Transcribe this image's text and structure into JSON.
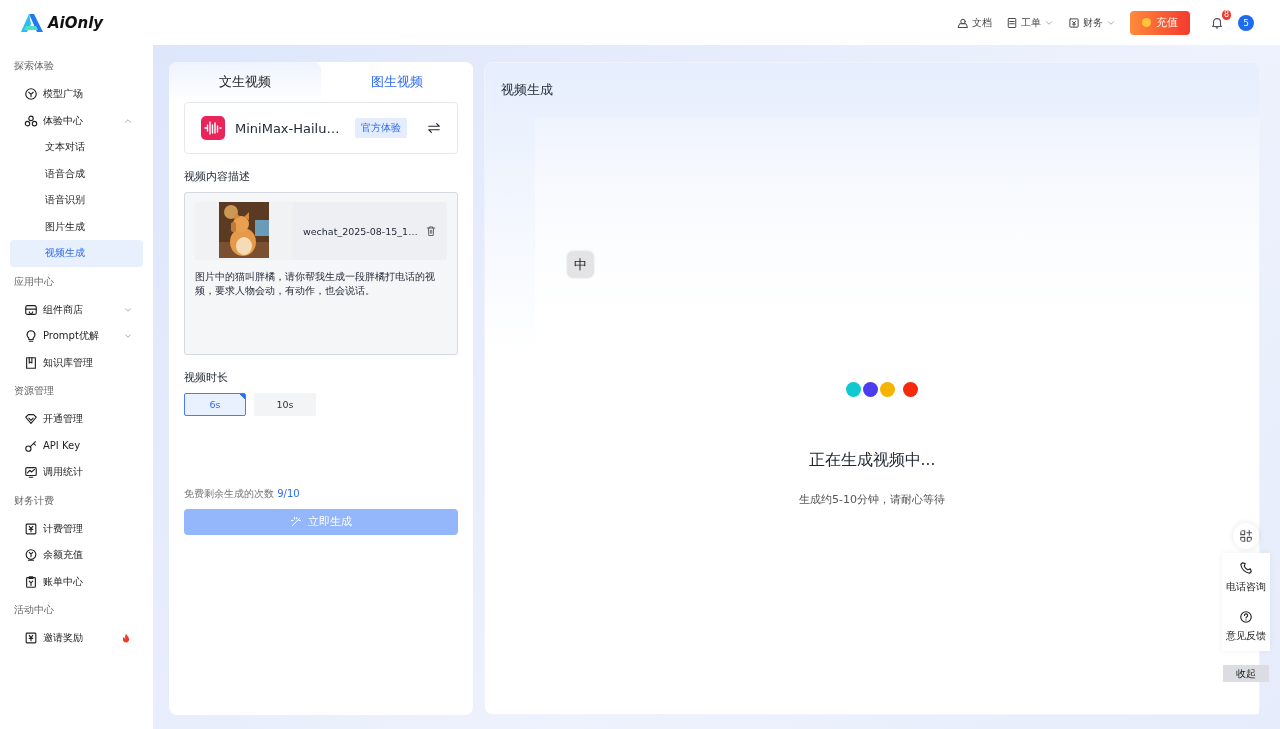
{
  "header": {
    "brand": "AiOnly",
    "nav": [
      {
        "label": "文档",
        "dropdown": false
      },
      {
        "label": "工单",
        "dropdown": true
      },
      {
        "label": "财务",
        "dropdown": true
      }
    ],
    "recharge": "充值",
    "notification_count": "8",
    "avatar": "5"
  },
  "sidebar": {
    "sections": [
      {
        "title": "探索体验",
        "items": [
          {
            "label": "模型广场",
            "selected": false
          },
          {
            "label": "体验中心",
            "selected": false,
            "expanded": true,
            "children": [
              {
                "label": "文本对话",
                "selected": false
              },
              {
                "label": "语音合成",
                "selected": false
              },
              {
                "label": "语音识别",
                "selected": false
              },
              {
                "label": "图片生成",
                "selected": false
              },
              {
                "label": "视频生成",
                "selected": true
              }
            ]
          }
        ]
      },
      {
        "title": "应用中心",
        "items": [
          {
            "label": "组件商店",
            "selected": false,
            "expanded": false
          },
          {
            "label": "Prompt优解",
            "selected": false,
            "expanded": false
          },
          {
            "label": "知识库管理",
            "selected": false
          }
        ]
      },
      {
        "title": "资源管理",
        "items": [
          {
            "label": "开通管理",
            "selected": false
          },
          {
            "label": "API Key",
            "selected": false
          },
          {
            "label": "调用统计",
            "selected": false
          }
        ]
      },
      {
        "title": "财务计费",
        "items": [
          {
            "label": "计费管理",
            "selected": false
          },
          {
            "label": "余额充值",
            "selected": false
          },
          {
            "label": "账单中心",
            "selected": false
          }
        ]
      },
      {
        "title": "活动中心",
        "items": [
          {
            "label": "邀请奖励",
            "selected": false,
            "hot": true
          }
        ]
      }
    ]
  },
  "left_panel": {
    "tabs": [
      {
        "label": "文生视频",
        "selected": false
      },
      {
        "label": "图生视频",
        "selected": true
      }
    ],
    "model": {
      "name": "MiniMax-Hailu…",
      "tag": "官方体验"
    },
    "description_label": "视频内容描述",
    "attachment": {
      "kind": "picture",
      "filename": "wechat_2025-08-15_1…"
    },
    "prompt": "图片中的猫叫胖橘，请你帮我生成一段胖橘打电话的视频，要求人物会动，有动作，也会说话。",
    "duration_label": "视频时长",
    "durations": [
      {
        "label": "6s",
        "selected": true
      },
      {
        "label": "10s",
        "selected": false
      }
    ],
    "quota_label": "免费剩余生成的次数",
    "quota": "9/10",
    "generate_button": {
      "label": "立即生成",
      "disabled": true
    }
  },
  "right_panel": {
    "title": "视频生成",
    "ime_indicator": "中",
    "loader_dots": [
      {
        "color": "#12c8d0"
      },
      {
        "color": "#4b3cf0"
      },
      {
        "color": "#f5b400"
      },
      {
        "color": "#f52a0c"
      }
    ],
    "status": "正在生成视频中...",
    "hint": "生成约5-10分钟，请耐心等待"
  },
  "float_tools": {
    "items": [
      {
        "label": "电话咨询"
      },
      {
        "label": "意见反馈"
      }
    ],
    "collapse": "收起"
  }
}
